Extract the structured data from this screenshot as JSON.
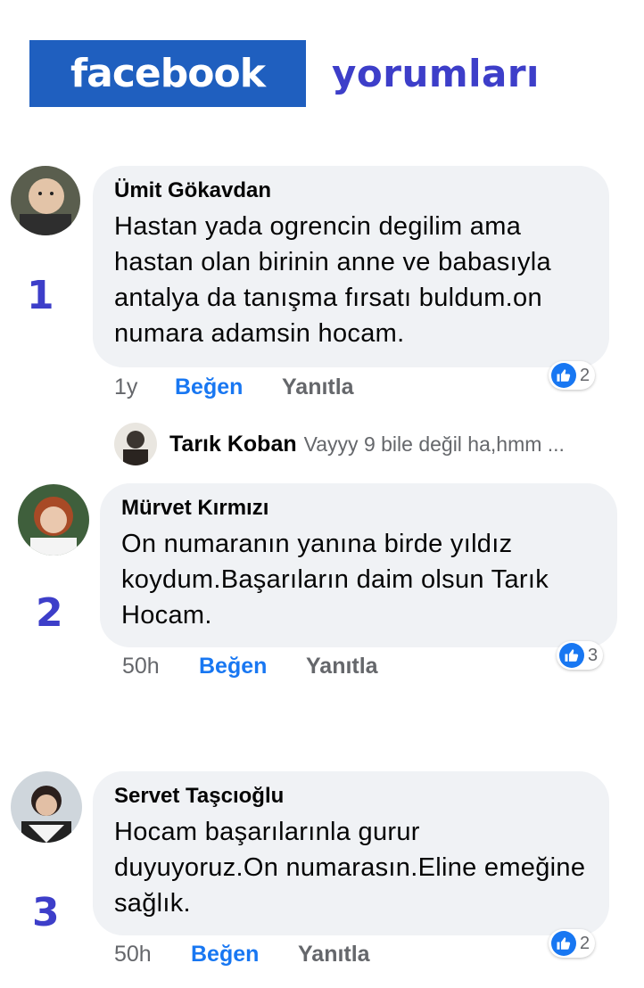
{
  "header": {
    "brand": "facebook",
    "title": "yorumları"
  },
  "comments": [
    {
      "number": "1",
      "author": "Ümit Gökavdan",
      "text": "Hastan yada ogrencin degilim ama hastan olan birinin anne ve babasıyla antalya da tanışma fırsatı buldum.on numara adamsin hocam.",
      "time": "1y",
      "like_label": "Beğen",
      "reply_label": "Yanıtla",
      "reaction_count": "2"
    },
    {
      "number": "2",
      "author": "Mürvet Kırmızı",
      "text": "On numaranın yanına birde yıldız koydum.Başarıların daim olsun Tarık Hocam.",
      "time": "50h",
      "like_label": "Beğen",
      "reply_label": "Yanıtla",
      "reaction_count": "3"
    },
    {
      "number": "3",
      "author": "Servet Taşcıoğlu",
      "text": "Hocam başarılarınla gurur duyuyoruz.On numarasın.Eline emeğine sağlık.",
      "time": "50h",
      "like_label": "Beğen",
      "reply_label": "Yanıtla",
      "reaction_count": "2"
    }
  ],
  "reply_preview": {
    "author": "Tarık Koban",
    "text": "Vayyy 9 bile değil ha,hmm ..."
  },
  "colors": {
    "brand": "#1f5fbf",
    "title": "#3d3ec9",
    "like": "#1877f2",
    "bubble": "#f0f2f5"
  }
}
